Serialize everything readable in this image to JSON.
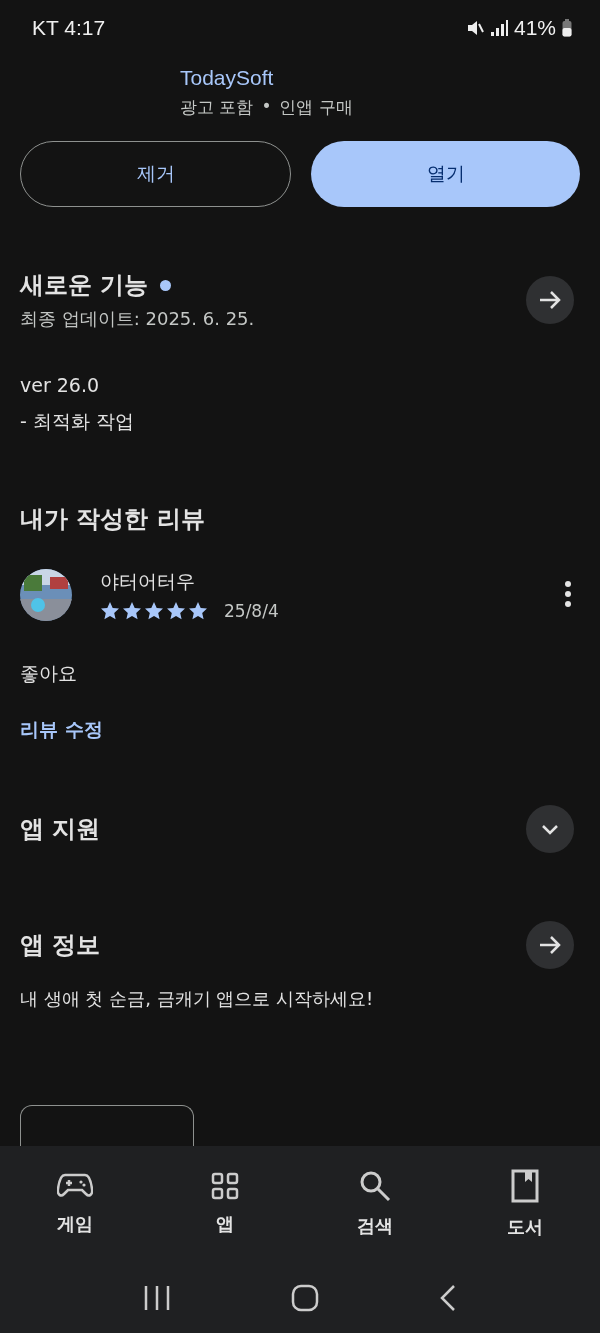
{
  "status_bar": {
    "carrier_time": "KT 4:17",
    "battery": "41%"
  },
  "app": {
    "developer": "TodaySoft",
    "notes": [
      "광고 포함",
      "인앱 구매"
    ],
    "separator": "•"
  },
  "actions": [
    {
      "label": "제거",
      "kind": "outline"
    },
    {
      "label": "열기",
      "kind": "filled"
    }
  ],
  "whats_new": {
    "title": "새로운 기능",
    "updated": "최종 업데이트: 2025. 6. 25.",
    "lines": [
      "ver 26.0",
      "- 최적화 작업"
    ]
  },
  "my_review": {
    "title": "내가 작성한 리뷰",
    "author": "야터어터우",
    "stars": 5,
    "date": "25/8/4",
    "text": "좋아요",
    "edit_link": "리뷰 수정"
  },
  "app_support": {
    "title": "앱 지원",
    "expanded": false
  },
  "app_info": {
    "title": "앱 정보",
    "description": "내 생애 첫 순금, 금캐기 앱으로 시작하세요!"
  },
  "bottom_nav": [
    {
      "label": "게임",
      "kind": "games"
    },
    {
      "label": "앱",
      "kind": "apps"
    },
    {
      "label": "검색",
      "kind": "search"
    },
    {
      "label": "도서",
      "kind": "books"
    }
  ]
}
